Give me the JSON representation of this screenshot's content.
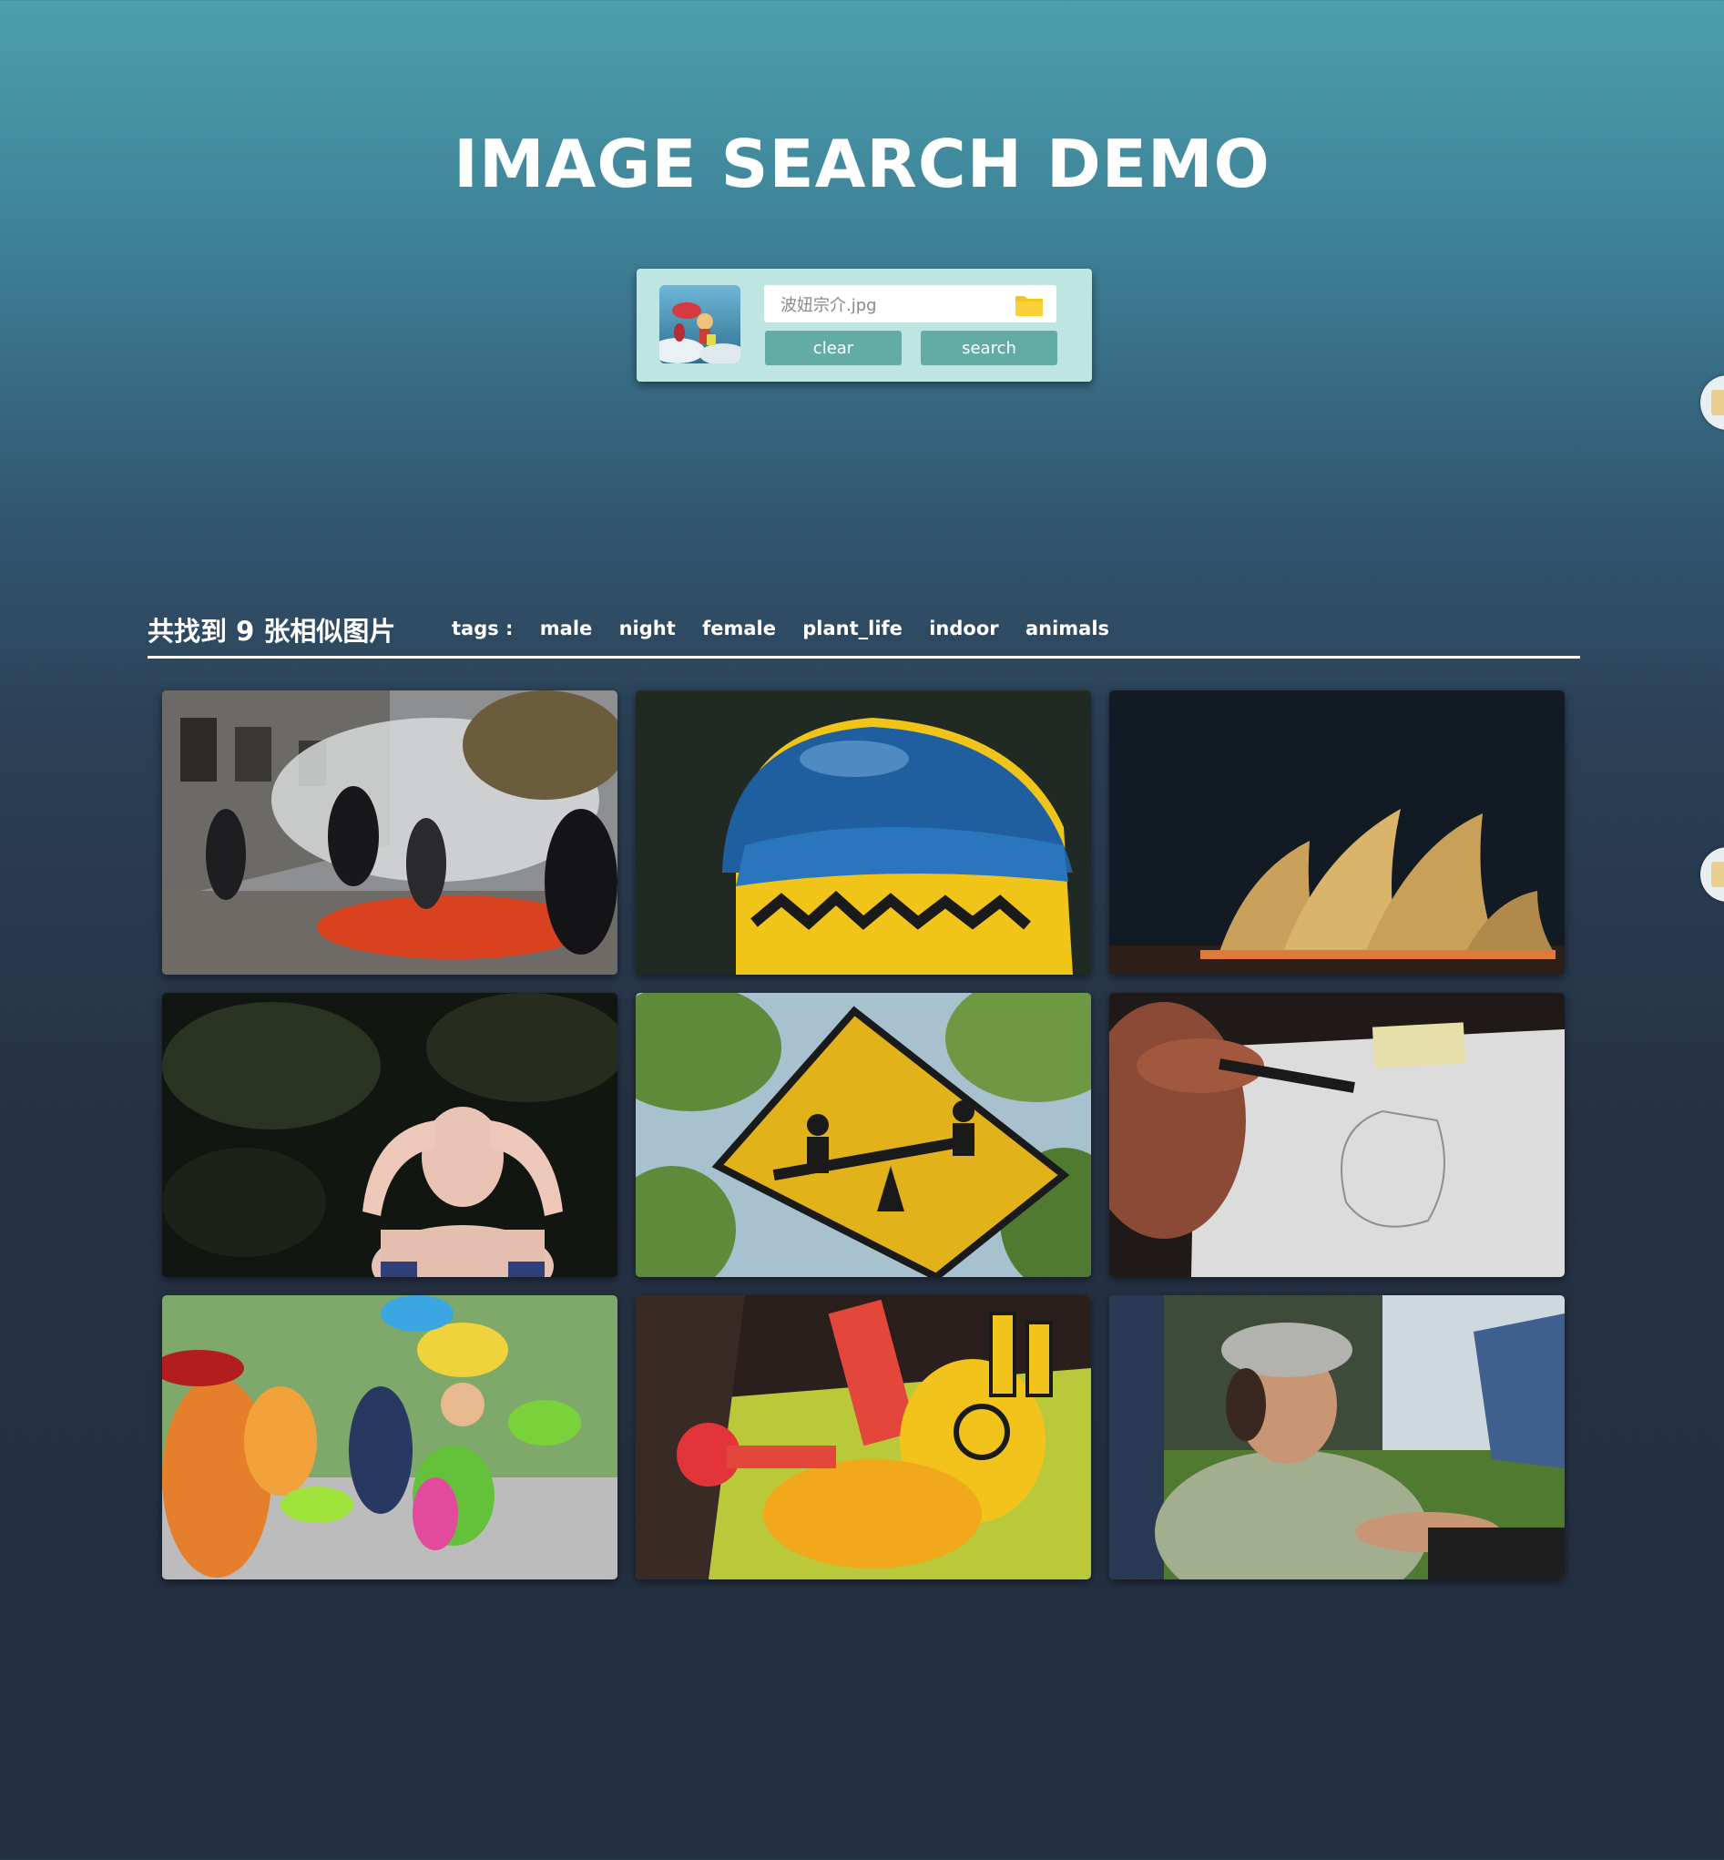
{
  "page": {
    "title": "IMAGE SEARCH DEMO"
  },
  "search": {
    "file_name": "波妞宗介.jpg",
    "clear_label": "clear",
    "search_label": "search",
    "icons": {
      "folder": "folder-icon",
      "thumbnail": "query-image-thumbnail"
    }
  },
  "results": {
    "count_text": "共找到 9 张相似图片",
    "tags_label": "tags :",
    "tags": [
      "male",
      "night",
      "female",
      "plant_life",
      "indoor",
      "animals"
    ],
    "images": [
      {
        "name": "result-image-street-protest"
      },
      {
        "name": "result-image-lego-figure-hat"
      },
      {
        "name": "result-image-opera-house-night"
      },
      {
        "name": "result-image-woman-covering-eyes"
      },
      {
        "name": "result-image-seesaw-sign"
      },
      {
        "name": "result-image-pencil-drawing"
      },
      {
        "name": "result-image-carnival-dancers"
      },
      {
        "name": "result-image-graffiti-robot-rabbit"
      },
      {
        "name": "result-image-man-in-cap"
      }
    ]
  },
  "colors": {
    "accent": "#62aca5",
    "search_panel": "#bfe5e3",
    "folder": "#f5c518",
    "bg_top": "#4aa0ac",
    "bg_bottom": "#232f40"
  }
}
